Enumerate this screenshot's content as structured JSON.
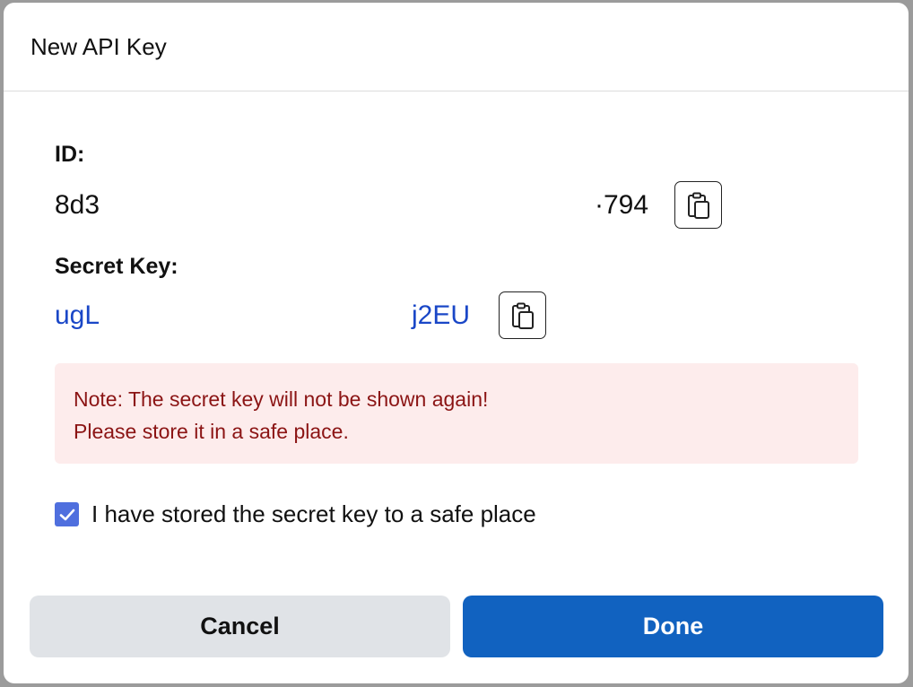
{
  "dialog": {
    "title": "New API Key"
  },
  "id_field": {
    "label": "ID:",
    "value_start": "8d3",
    "value_end": "·794"
  },
  "secret_field": {
    "label": "Secret Key:",
    "value_start": "ugL",
    "value_end": "j2EU"
  },
  "note": {
    "line1": "Note: The secret key will not be shown again!",
    "line2": "Please store it in a safe place."
  },
  "confirm": {
    "label": "I have stored the secret key to a safe place",
    "checked": true
  },
  "actions": {
    "cancel_label": "Cancel",
    "done_label": "Done"
  },
  "icons": {
    "copy": "clipboard-copy-icon",
    "check": "checkmark-icon"
  },
  "colors": {
    "secret_text": "#1a47c7",
    "note_bg": "#fdecec",
    "note_text": "#8b1414",
    "checkbox": "#4f6fde",
    "done_button": "#1162c0",
    "cancel_button": "#e0e3e7"
  }
}
